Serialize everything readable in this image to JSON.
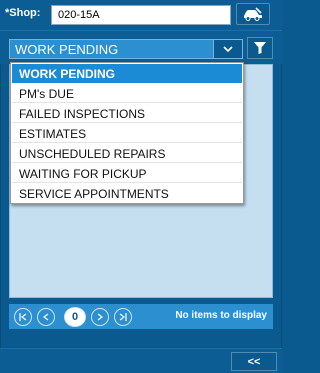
{
  "header": {
    "shop_label": "*Shop:",
    "shop_value": "020-15A",
    "vehicle_icon": "car-wrench-icon"
  },
  "toolbar": {
    "selected_view": "WORK PENDING",
    "dropdown_icon": "chevron-down-icon",
    "filter_icon": "filter-icon"
  },
  "dropdown": {
    "items": [
      {
        "label": "WORK PENDING",
        "selected": true
      },
      {
        "label": "PM's DUE",
        "selected": false
      },
      {
        "label": "FAILED INSPECTIONS",
        "selected": false
      },
      {
        "label": "ESTIMATES",
        "selected": false
      },
      {
        "label": "UNSCHEDULED REPAIRS",
        "selected": false
      },
      {
        "label": "WAITING FOR PICKUP",
        "selected": false
      },
      {
        "label": "SERVICE APPOINTMENTS",
        "selected": false
      }
    ]
  },
  "pager": {
    "page_number": "0",
    "status_text": "No items to display"
  },
  "footer": {
    "collapse_label": "<<"
  },
  "colors": {
    "frame": "#0a5a8f",
    "selection": "#1b8bd6",
    "panel": "#c5dff0"
  }
}
